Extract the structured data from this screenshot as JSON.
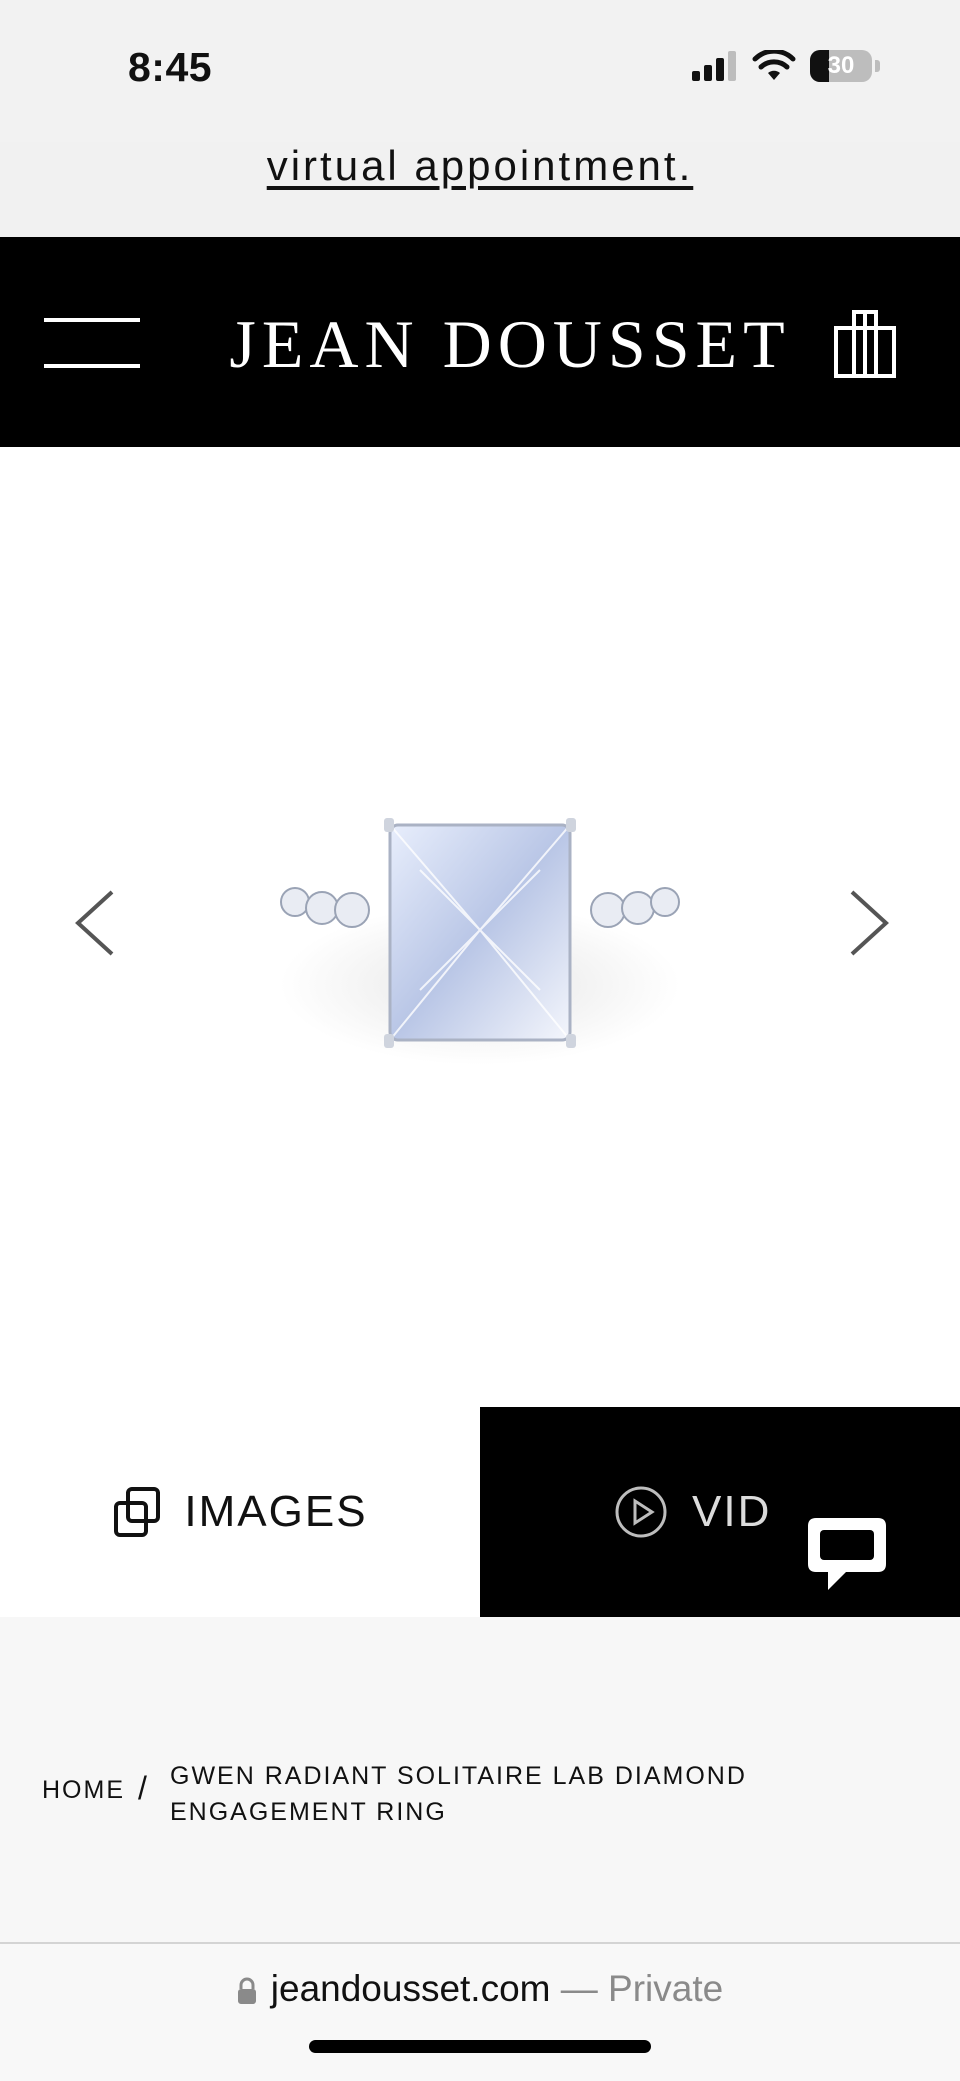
{
  "status_bar": {
    "time": "8:45",
    "battery": "30"
  },
  "promo": {
    "link_text": "virtual appointment."
  },
  "header": {
    "brand": "JEAN DOUSSET"
  },
  "gallery": {
    "image_alt": "Gwen radiant solitaire lab diamond engagement ring"
  },
  "media_tabs": {
    "images_label": "IMAGES",
    "video_label": "VID"
  },
  "breadcrumb": {
    "home": "HOME",
    "separator": "/",
    "current": "GWEN RADIANT SOLITAIRE LAB DIAMOND ENGAGEMENT RING"
  },
  "browser": {
    "domain": "jeandousset.com",
    "privacy": "— Private"
  },
  "colors": {
    "header_bg": "#000000",
    "promo_bg": "#f1f1f1",
    "page_bg": "#f7f7f7"
  }
}
